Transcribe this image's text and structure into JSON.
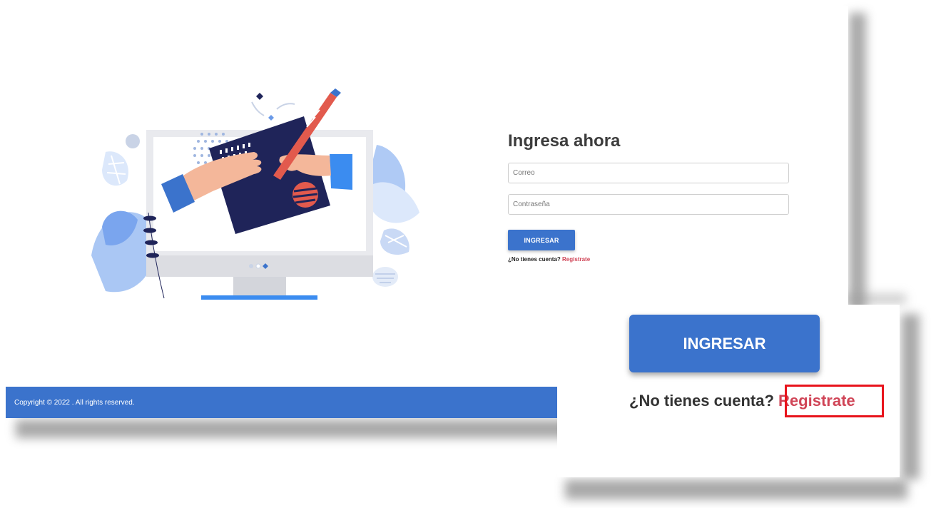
{
  "login": {
    "title": "Ingresa ahora",
    "email_placeholder": "Correo",
    "password_placeholder": "Contraseña",
    "submit_label": "INGRESAR",
    "signup_prompt": "¿No tienes cuenta?",
    "signup_link": "Registrate"
  },
  "footer": {
    "copyright": "Copyright © 2022 . All rights reserved."
  },
  "zoom": {
    "submit_label": "INGRESAR",
    "signup_prompt": "¿No tienes cuenta?",
    "signup_link": "Registrate"
  },
  "colors": {
    "primary": "#3b73cc",
    "link": "#d04557",
    "highlight": "#e8141c",
    "illustration_navy": "#1f2459"
  },
  "icons": [
    "monitor-illustration",
    "hand-icon",
    "pen-icon",
    "leaf-icon"
  ]
}
